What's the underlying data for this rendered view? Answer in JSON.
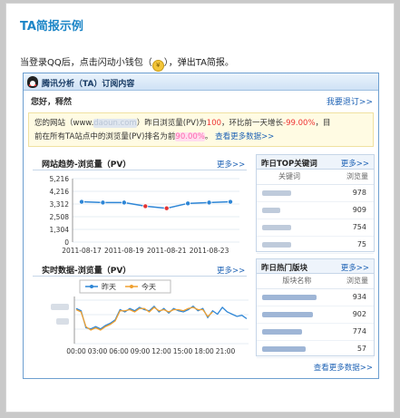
{
  "doc": {
    "title": "TA简报示例",
    "instruction_before": "当登录QQ后，点击闪动小钱包（",
    "instruction_after": "），弹出TA简报。"
  },
  "popup": {
    "title": "腾讯分析（TA）订阅内容",
    "greeting": "您好，释然",
    "unsubscribe": "我要退订>>",
    "notice": {
      "p1": "您的网站（www.",
      "site_hidden": "daoun.com",
      "p2": "）昨日浏览量(PV)为",
      "pv": "100",
      "p3": "，环比前一天增长",
      "growth": "-99.00%",
      "p4": "，目",
      "p5": "前在所有TA站点中的浏览量(PV)排名为前",
      "rank_hidden": "90.00%",
      "p6": "。",
      "more_link": "查看更多数据>>"
    },
    "trend": {
      "title": "网站趋势-浏览量（PV）",
      "more": "更多>>"
    },
    "realtime": {
      "title": "实时数据-浏览量（PV）",
      "more": "更多>>",
      "legend_yesterday": "昨天",
      "legend_today": "今天"
    },
    "keywords": {
      "title": "昨日TOP关键词",
      "more": "更多>>",
      "col_key": "关键词",
      "col_pv": "浏览量",
      "rows": [
        {
          "key": "dacus",
          "pv": "978"
        },
        {
          "key": "dr",
          "pv": "909"
        },
        {
          "key": "dacus",
          "pv": "754"
        },
        {
          "key": "dacus",
          "pv": "75"
        }
      ]
    },
    "blocks": {
      "title": "昨日热门版块",
      "more": "更多>>",
      "col_name": "版块名称",
      "col_pv": "浏览量",
      "rows": [
        {
          "name": "Bexuasdfasdf",
          "pv": "934"
        },
        {
          "name": "Bexuas fasd",
          "pv": "902"
        },
        {
          "name": "Bexuasdf",
          "pv": "774"
        },
        {
          "name": "Bexuasdfa",
          "pv": "57"
        }
      ]
    },
    "footer_link": "查看更多数据>>"
  },
  "colors": {
    "title_blue": "#1d86c7",
    "link_blue": "#1f63b5",
    "series_blue": "#2e86d6",
    "series_orange": "#f0a030",
    "marker_red": "#e33333"
  },
  "chart_data": [
    {
      "type": "line",
      "title": "网站趋势-浏览量（PV）",
      "x": [
        "2011-08-17",
        "2011-08-18",
        "2011-08-19",
        "2011-08-20",
        "2011-08-21",
        "2011-08-22",
        "2011-08-23",
        "2011-08-24"
      ],
      "x_tick_labels": [
        "2011-08-17",
        "2011-08-19",
        "2011-08-21",
        "2011-08-23"
      ],
      "y_tick_labels": [
        "5,216",
        "4,216",
        "3,312",
        "2,508",
        "1,304",
        "0"
      ],
      "ylim": [
        0,
        5216
      ],
      "series": [
        {
          "values": [
            3312,
            3250,
            3250,
            2950,
            2780,
            3180,
            3250,
            3312
          ]
        }
      ],
      "highlight_points": [
        3,
        4
      ],
      "grid": true
    },
    {
      "type": "line",
      "title": "实时数据-浏览量（PV）",
      "x_tick_labels": [
        "00:00",
        "03:00",
        "06:00",
        "09:00",
        "12:00",
        "15:00",
        "18:00",
        "21:00"
      ],
      "series": [
        {
          "name": "昨天",
          "values": [
            62,
            58,
            28,
            26,
            30,
            26,
            32,
            36,
            42,
            60,
            56,
            62,
            58,
            64,
            60,
            58,
            66,
            56,
            62,
            54,
            62,
            58,
            56,
            60,
            66,
            58,
            62,
            46,
            58,
            52,
            64,
            56,
            52,
            48,
            50,
            44
          ]
        },
        {
          "name": "今天",
          "values": [
            60,
            56,
            30,
            24,
            28,
            24,
            30,
            34,
            40,
            58,
            58,
            60,
            56,
            62,
            62,
            56,
            64,
            58,
            60,
            56,
            60,
            60,
            58,
            62,
            64,
            60,
            60,
            48,
            56
          ]
        }
      ],
      "grid": true,
      "legend": "top-left"
    }
  ]
}
